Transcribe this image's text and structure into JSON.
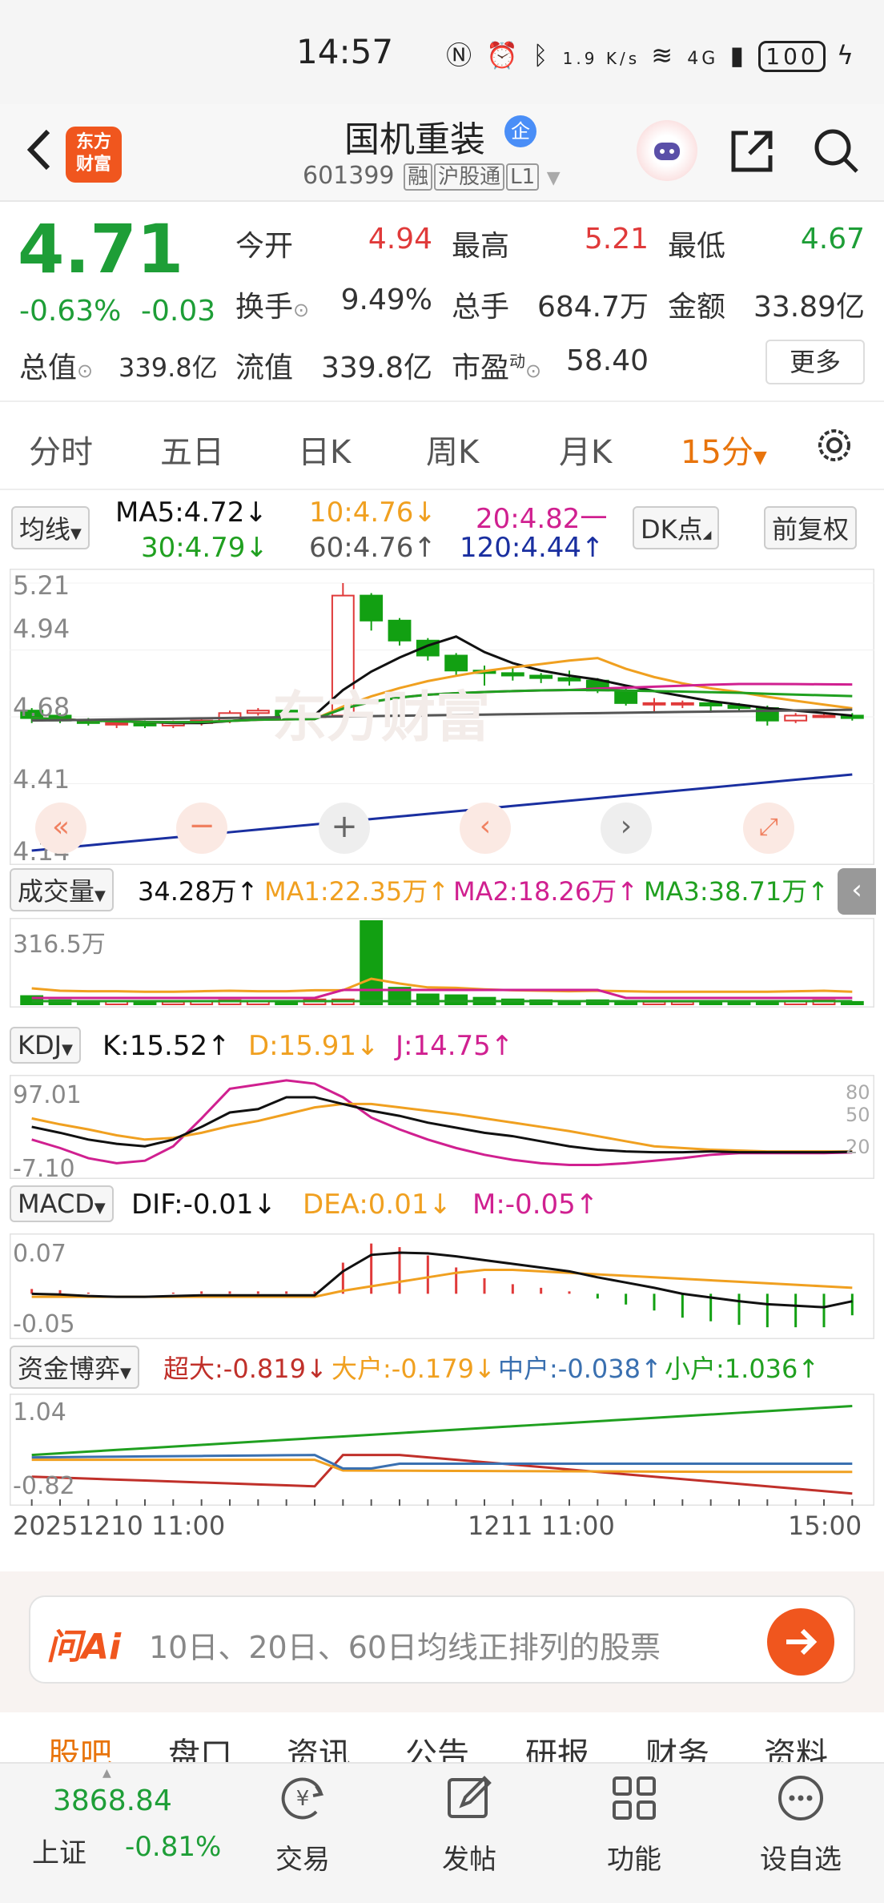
{
  "status_bar": {
    "time": "14:57",
    "network_speed": "1.9 K/s",
    "signal": "4G",
    "battery": "100"
  },
  "header": {
    "logo_text_line1": "东方",
    "logo_text_line2": "财富",
    "stock_name": "国机重装",
    "enterprise_badge": "企",
    "stock_code": "601399",
    "tags": [
      "融",
      "沪股通",
      "L1"
    ]
  },
  "quote": {
    "price": "4.71",
    "change_pct": "-0.63%",
    "change_abs": "-0.03",
    "open_label": "今开",
    "open_value": "4.94",
    "high_label": "最高",
    "high_value": "5.21",
    "low_label": "最低",
    "low_value": "4.67",
    "turnover_label": "换手",
    "turnover_value": "9.49%",
    "volume_label": "总手",
    "volume_value": "684.7万",
    "amount_label": "金额",
    "amount_value": "33.89亿",
    "mktcap_label": "总值",
    "mktcap_value": "339.8亿",
    "float_label": "流值",
    "float_value": "339.8亿",
    "pe_label": "市盈",
    "pe_sup": "动",
    "pe_value": "58.40",
    "more_label": "更多"
  },
  "period_tabs": [
    "分时",
    "五日",
    "日K",
    "周K",
    "月K",
    "15分"
  ],
  "active_period": "15分",
  "chart": {
    "ma_selector": "均线",
    "ma5": "MA5:4.72↓",
    "ma10": "10:4.76↓",
    "ma20": "20:4.82一",
    "ma30": "30:4.79↓",
    "ma60": "60:4.76↑",
    "ma120": "120:4.44↑",
    "dk_button": "DK点",
    "adjust_button": "前复权",
    "price_ticks": [
      "5.21",
      "4.94",
      "4.68",
      "4.41",
      "4.14"
    ],
    "watermark": "东方财富",
    "volume_selector": "成交量",
    "volume_value": "34.28万↑",
    "vol_ma1": "MA1:22.35万↑",
    "vol_ma2": "MA2:18.26万↑",
    "vol_ma3": "MA3:38.71万↑",
    "volume_tick": "316.5万",
    "kdj_selector": "KDJ",
    "kdj_k": "K:15.52↑",
    "kdj_d": "D:15.91↓",
    "kdj_j": "J:14.75↑",
    "kdj_ticks": [
      "97.01",
      "-7.10"
    ],
    "kdj_right_ticks": [
      "80",
      "50",
      "20"
    ],
    "macd_selector": "MACD",
    "macd_dif": "DIF:-0.01↓",
    "macd_dea": "DEA:0.01↓",
    "macd_m": "M:-0.05↑",
    "macd_ticks": [
      "0.07",
      "-0.05"
    ],
    "fund_selector": "资金博弈",
    "fund_super": "超大:-0.819↓",
    "fund_large": "大户:-0.179↓",
    "fund_mid": "中户:-0.038↑",
    "fund_small": "小户:1.036↑",
    "fund_ticks": [
      "1.04",
      "-0.82"
    ],
    "time_axis": [
      "20251210 11:00",
      "1211 11:00",
      "15:00"
    ],
    "colors": {
      "up": "#e03a3a",
      "down": "#12a012",
      "ma5": "#111111",
      "ma10": "#f0a020",
      "ma20": "#d02090",
      "ma30": "#20a020",
      "ma60": "#555555",
      "ma120": "#1a2fa0"
    }
  },
  "chart_data": {
    "type": "candlestick",
    "interval": "15分",
    "candles": [
      {
        "open": 4.7,
        "close": 4.67,
        "high": 4.71,
        "low": 4.65
      },
      {
        "open": 4.68,
        "close": 4.66,
        "high": 4.69,
        "low": 4.65
      },
      {
        "open": 4.66,
        "close": 4.65,
        "high": 4.67,
        "low": 4.64
      },
      {
        "open": 4.65,
        "close": 4.65,
        "high": 4.66,
        "low": 4.63
      },
      {
        "open": 4.65,
        "close": 4.64,
        "high": 4.66,
        "low": 4.63
      },
      {
        "open": 4.64,
        "close": 4.65,
        "high": 4.66,
        "low": 4.63
      },
      {
        "open": 4.65,
        "close": 4.66,
        "high": 4.67,
        "low": 4.64
      },
      {
        "open": 4.66,
        "close": 4.69,
        "high": 4.7,
        "low": 4.65
      },
      {
        "open": 4.69,
        "close": 4.7,
        "high": 4.71,
        "low": 4.68
      },
      {
        "open": 4.7,
        "close": 4.68,
        "high": 4.71,
        "low": 4.67
      },
      {
        "open": 4.68,
        "close": 4.68,
        "high": 4.69,
        "low": 4.67
      },
      {
        "open": 4.68,
        "close": 5.16,
        "high": 5.21,
        "low": 4.7
      },
      {
        "open": 5.16,
        "close": 5.06,
        "high": 5.17,
        "low": 5.02
      },
      {
        "open": 5.06,
        "close": 4.98,
        "high": 5.07,
        "low": 4.96
      },
      {
        "open": 4.98,
        "close": 4.92,
        "high": 4.99,
        "low": 4.9
      },
      {
        "open": 4.92,
        "close": 4.86,
        "high": 4.93,
        "low": 4.84
      },
      {
        "open": 4.86,
        "close": 4.85,
        "high": 4.88,
        "low": 4.8
      },
      {
        "open": 4.85,
        "close": 4.84,
        "high": 4.87,
        "low": 4.82
      },
      {
        "open": 4.84,
        "close": 4.83,
        "high": 4.85,
        "low": 4.81
      },
      {
        "open": 4.83,
        "close": 4.82,
        "high": 4.86,
        "low": 4.8
      },
      {
        "open": 4.82,
        "close": 4.78,
        "high": 4.83,
        "low": 4.77
      },
      {
        "open": 4.78,
        "close": 4.73,
        "high": 4.79,
        "low": 4.72
      },
      {
        "open": 4.73,
        "close": 4.73,
        "high": 4.75,
        "low": 4.69
      },
      {
        "open": 4.73,
        "close": 4.73,
        "high": 4.74,
        "low": 4.71
      },
      {
        "open": 4.73,
        "close": 4.72,
        "high": 4.74,
        "low": 4.7
      },
      {
        "open": 4.72,
        "close": 4.71,
        "high": 4.73,
        "low": 4.7
      },
      {
        "open": 4.71,
        "close": 4.66,
        "high": 4.72,
        "low": 4.64
      },
      {
        "open": 4.66,
        "close": 4.68,
        "high": 4.69,
        "low": 4.65
      },
      {
        "open": 4.68,
        "close": 4.68,
        "high": 4.69,
        "low": 4.67
      },
      {
        "open": 4.68,
        "close": 4.67,
        "high": 4.69,
        "low": 4.66
      }
    ],
    "ylim": [
      4.14,
      5.21
    ],
    "volume": [
      0.1,
      0.05,
      0.04,
      0.04,
      0.03,
      0.03,
      0.04,
      0.05,
      0.04,
      0.04,
      0.06,
      0.06,
      1.0,
      0.2,
      0.12,
      0.11,
      0.08,
      0.06,
      0.05,
      0.04,
      0.05,
      0.04,
      0.03,
      0.03,
      0.03,
      0.03,
      0.03,
      0.04,
      0.05,
      0.03
    ],
    "volume_max": "316.5万",
    "kdj": {
      "k_last": 15.52,
      "d_last": 15.91,
      "j_last": 14.75,
      "ylim": [
        -7.1,
        97.01
      ]
    },
    "macd": {
      "dif_last": -0.01,
      "dea_last": 0.01,
      "m_last": -0.05,
      "ylim": [
        -0.05,
        0.07
      ]
    },
    "fund_flow": {
      "super": -0.819,
      "large": -0.179,
      "mid": -0.038,
      "small": 1.036,
      "ylim": [
        -0.82,
        1.04
      ]
    }
  },
  "ai_bar": {
    "logo": "问Ai",
    "prompt": "10日、20日、60日均线正排列的股票"
  },
  "bottom_tabs": [
    "股吧",
    "盘口",
    "资讯",
    "公告",
    "研报",
    "财务",
    "资料"
  ],
  "active_bottom_tab": "股吧",
  "nav": {
    "index_value": "3868.84",
    "index_name": "上证",
    "index_change": "-0.81%",
    "items": [
      "交易",
      "发帖",
      "功能",
      "设自选"
    ]
  }
}
